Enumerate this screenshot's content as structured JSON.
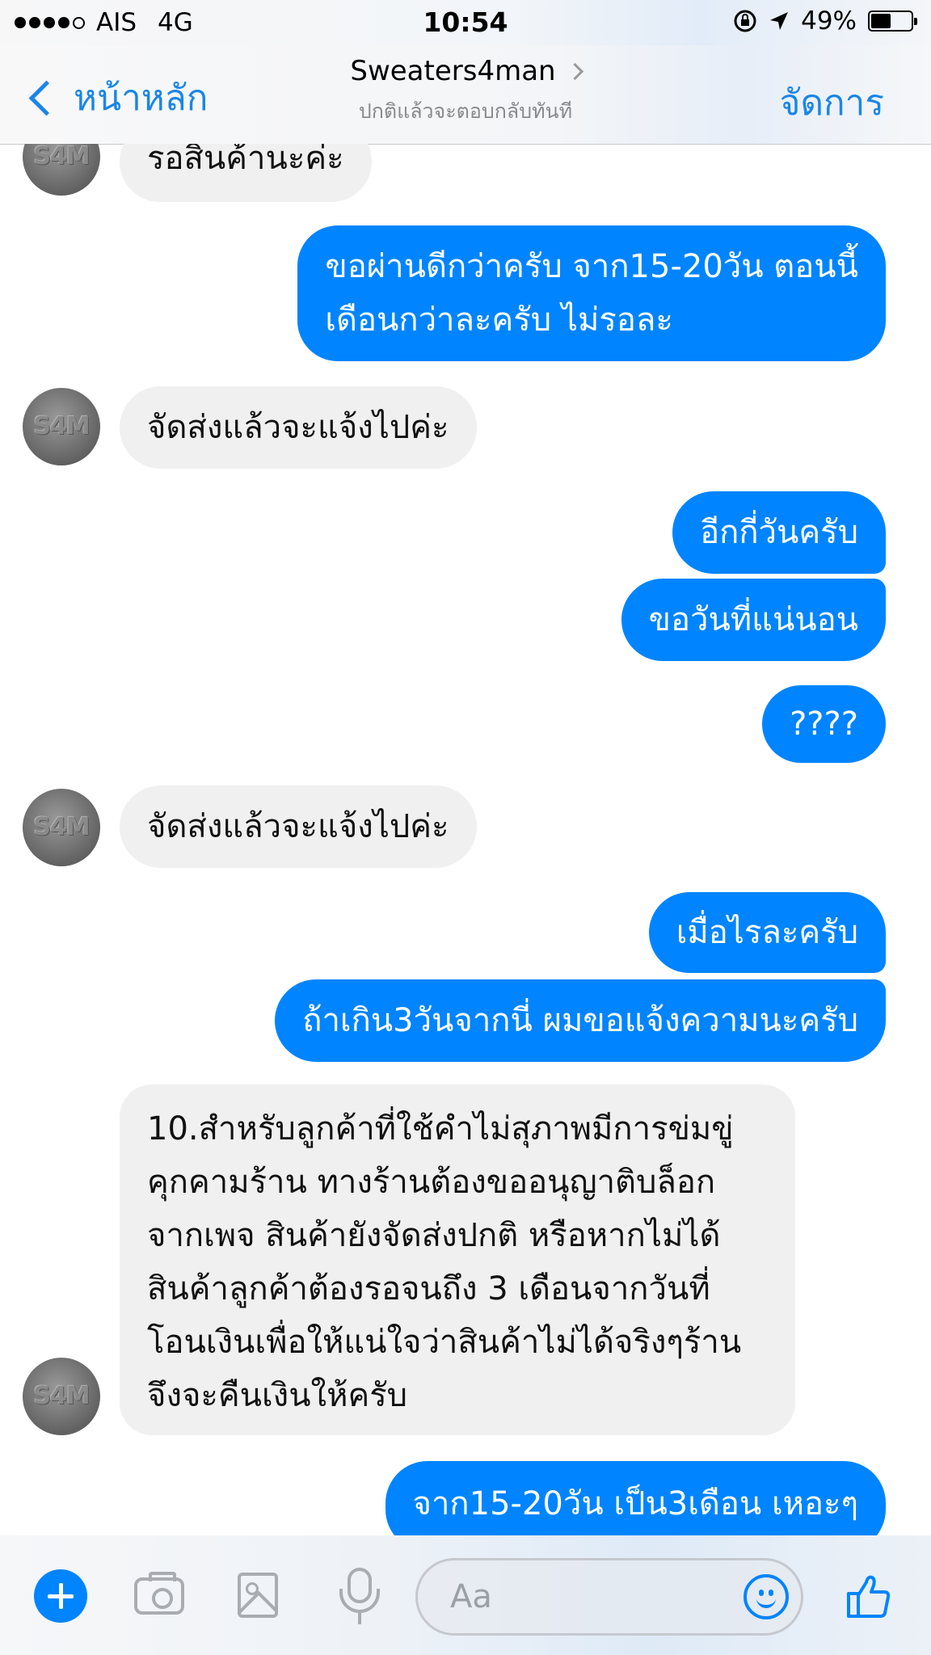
{
  "status_bar": {
    "carrier": "AIS",
    "network": "4G",
    "time": "10:54",
    "battery": "49%",
    "battery_level": 0.49,
    "icons": [
      "signal-dots",
      "orientation-lock-icon",
      "location-arrow-icon",
      "battery-icon"
    ]
  },
  "nav": {
    "back_label": "หน้าหลัก",
    "contact_name": "Sweaters4man",
    "subtitle": "ปกติแล้วจะตอบกลับทันที",
    "manage_label": "จัดการ"
  },
  "avatar_text": "S4M",
  "messages": [
    {
      "side": "in",
      "text": "รอสินค้านะค่ะ"
    },
    {
      "side": "out",
      "lines": [
        "ขอผ่านดีกว่าครับ จาก15-20วัน ตอนนี้",
        "เดือนกว่าละครับ ไม่รอละ"
      ]
    },
    {
      "side": "in",
      "text": "จัดส่งแล้วจะแจ้งไปค่ะ"
    },
    {
      "side": "out",
      "text": "อีกกี่วันครับ"
    },
    {
      "side": "out",
      "text": "ขอวันที่แน่นอน"
    },
    {
      "side": "out",
      "text": "????"
    },
    {
      "side": "in",
      "text": "จัดส่งแล้วจะแจ้งไปค่ะ"
    },
    {
      "side": "out",
      "text": "เมื่อไรละครับ"
    },
    {
      "side": "out",
      "text": "ถ้าเกิน3วันจากนี่ ผมขอแจ้งความนะครับ"
    },
    {
      "side": "in",
      "lines": [
        "10.สำหรับลูกค้าที่ใช้คำไม่สุภาพมีการข่มขู่",
        "คุกคามร้าน ทางร้านต้องขออนุญาติบล็อก",
        "จากเพจ สินค้ายังจัดส่งปกติ หรือหากไม่ได้",
        "สินค้าลูกค้าต้องรอจนถึง 3 เดือนจากวันที่",
        "โอนเงินเพื่อให้แน่ใจว่าสินค้าไม่ได้จริงๆร้าน",
        "จึงจะคืนเงินให้ครับ"
      ]
    },
    {
      "side": "out",
      "text": "จาก15-20วัน เป็น3เดือน เหอะๆ"
    }
  ],
  "composer": {
    "placeholder": "Aa",
    "icons": [
      "plus-icon",
      "camera-icon",
      "image-icon",
      "microphone-icon",
      "emoji-icon",
      "like-icon"
    ]
  },
  "colors": {
    "accent": "#0084ff",
    "incoming_bubble": "#f0f0f0",
    "nav_link": "#1a86e8"
  }
}
